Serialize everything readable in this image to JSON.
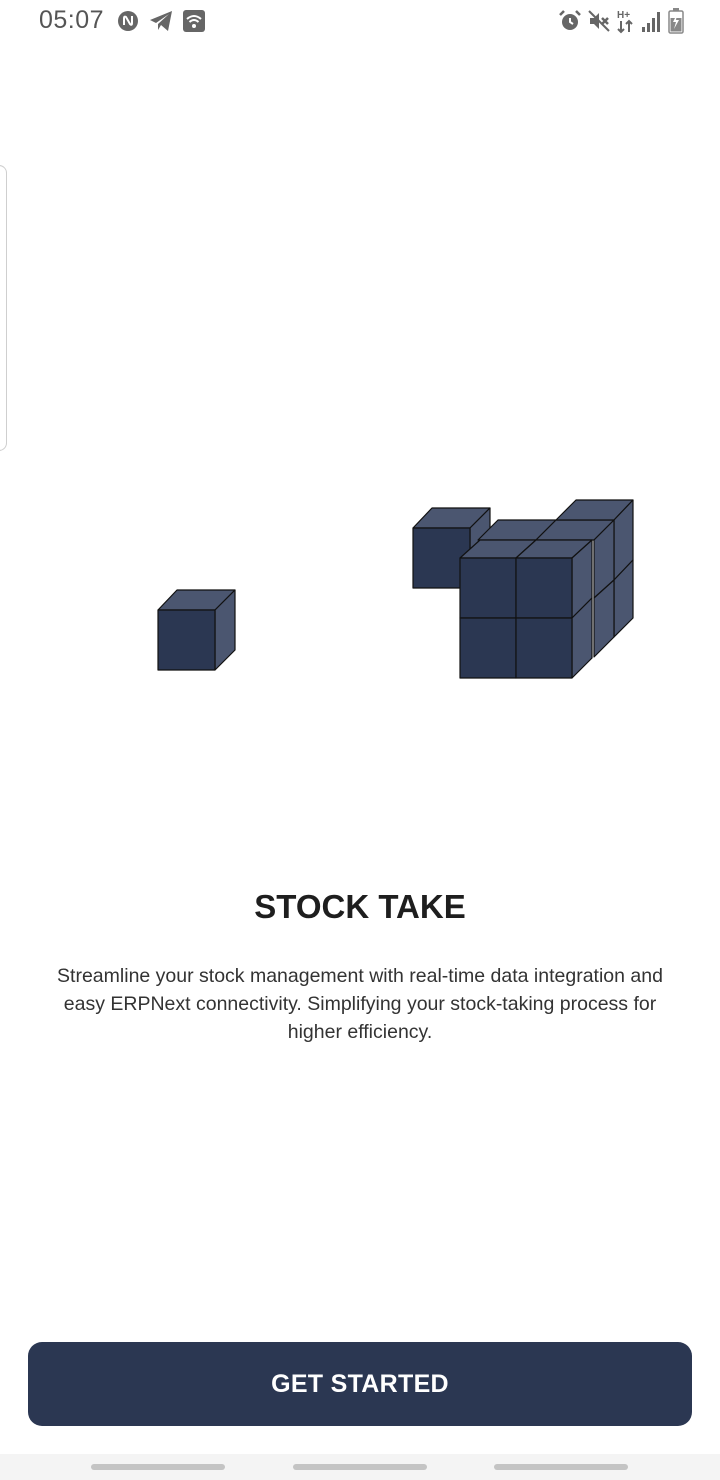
{
  "status_bar": {
    "time": "05:07",
    "left_icons": [
      "nfc-icon",
      "telegram-icon",
      "wifi-call-icon"
    ],
    "right_icons": [
      "alarm-icon",
      "mute-icon",
      "network-hplus-icon",
      "signal-icon",
      "battery-charging-icon"
    ]
  },
  "onboarding": {
    "title": "STOCK TAKE",
    "description": "Streamline your stock management with real-time data integration and easy ERPNext connectivity. Simplifying your stock-taking process for higher efficiency.",
    "cta_label": "GET STARTED",
    "illustration": "stock-boxes-illustration"
  },
  "colors": {
    "primary": "#2b3752",
    "cube_front": "#2b3752",
    "cube_top": "#4b5670",
    "cube_side": "#3d4862",
    "background": "#ffffff"
  }
}
